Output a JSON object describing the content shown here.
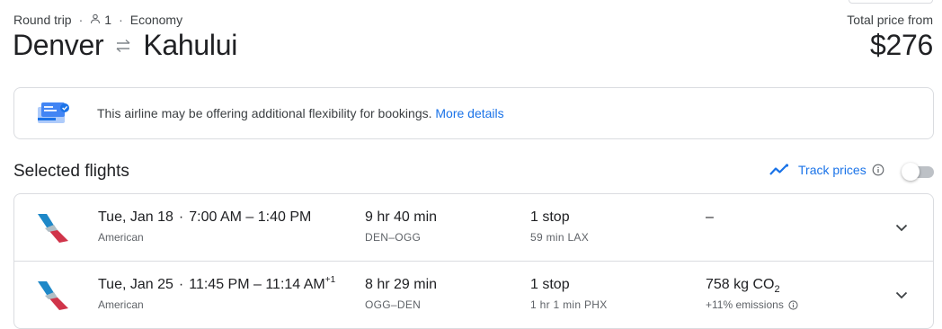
{
  "header": {
    "trip_type": "Round trip",
    "passengers": "1",
    "cabin": "Economy",
    "origin": "Denver",
    "destination": "Kahului",
    "price_label": "Total price from",
    "price": "$276"
  },
  "notice": {
    "text": "This airline may be offering additional flexibility for bookings.",
    "link": "More details"
  },
  "section": {
    "title": "Selected flights",
    "track_label": "Track prices",
    "track_enabled": false
  },
  "flights": [
    {
      "date": "Tue, Jan 18",
      "depart": "7:00 AM",
      "arrive": "1:40 PM",
      "day_offset": "",
      "airline": "American",
      "duration": "9 hr 40 min",
      "airports": "DEN–OGG",
      "stops": "1 stop",
      "layover": "59 min LAX",
      "emissions": "–",
      "emissions_unit": "",
      "emissions_delta": ""
    },
    {
      "date": "Tue, Jan 25",
      "depart": "11:45 PM",
      "arrive": "11:14 AM",
      "day_offset": "+1",
      "airline": "American",
      "duration": "8 hr 29 min",
      "airports": "OGG–DEN",
      "stops": "1 stop",
      "layover": "1 hr 1 min PHX",
      "emissions": "758 kg CO",
      "emissions_unit": "2",
      "emissions_delta": "+11% emissions"
    }
  ],
  "colors": {
    "accent": "#1a73e8",
    "border": "#dadce0",
    "text_secondary": "#5f6368",
    "airline_red": "#d0344a",
    "airline_blue": "#1e88c8"
  },
  "icons": {
    "person": "person-icon",
    "swap": "swap-arrows-icon",
    "notice": "booking-flexibility-icon",
    "trend": "trending-line-icon",
    "info": "info-icon",
    "expand": "chevron-down-icon",
    "airline": "american-airlines-logo"
  }
}
